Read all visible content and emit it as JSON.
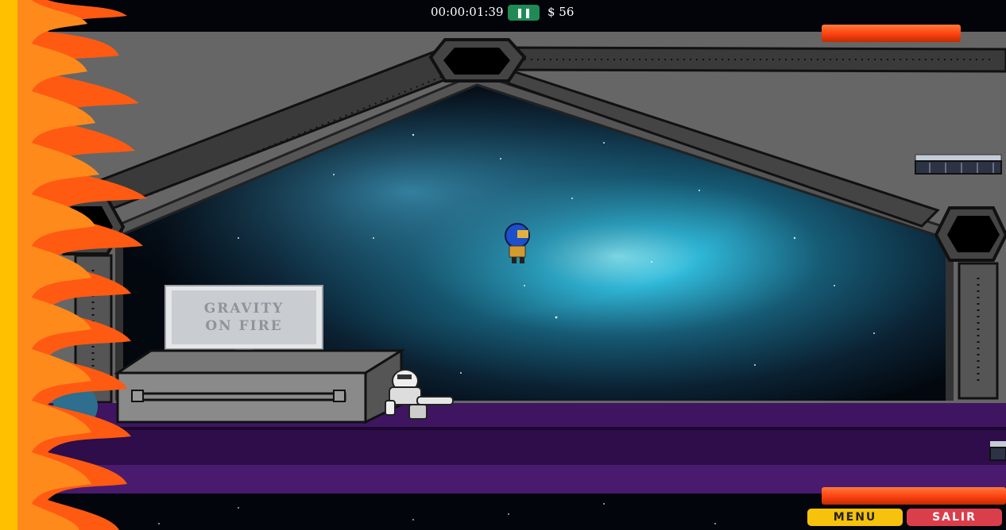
{
  "hud": {
    "timer": "00:00:01:39",
    "pause_icon": "pause-icon",
    "money": "$ 56"
  },
  "sign": {
    "line1": "GRAVITY",
    "line2": "ON FIRE"
  },
  "buttons": {
    "menu": "MENU",
    "salir": "SALIR"
  },
  "colors": {
    "hud_button": "#1f8a55",
    "menu_button": "#f7c20b",
    "salir_button": "#db3e4b",
    "floor": "#4a1a6e",
    "platform": "#ff4a14"
  }
}
